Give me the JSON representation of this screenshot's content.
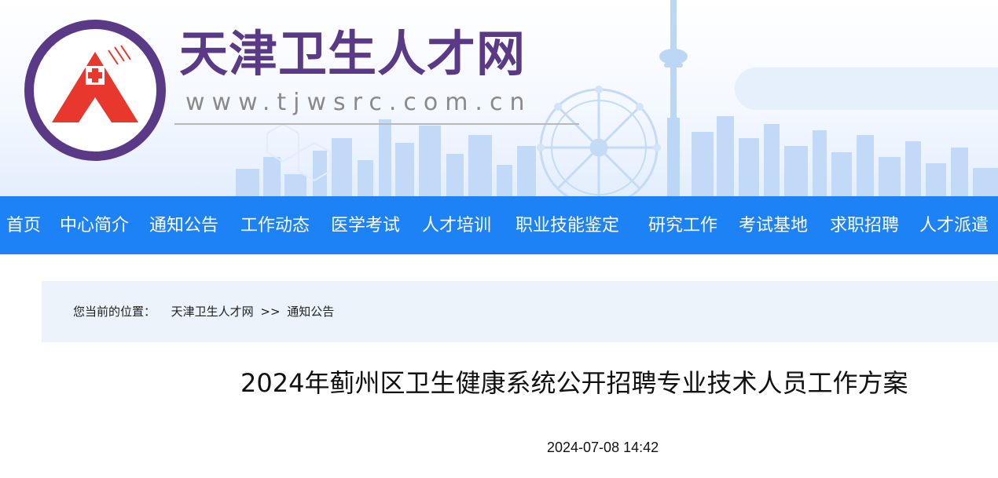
{
  "header": {
    "site_name": "天津卫生人才网",
    "site_url": "www.tjwsrc.com.cn",
    "logo_icon": "red-cross-mountain-logo-icon",
    "colors": {
      "logo_ring": "#5a3a86",
      "logo_red": "#e8372c",
      "skyline": "#b9d4f5"
    }
  },
  "nav": {
    "background": "#1e82f7",
    "items": [
      {
        "label": "首页"
      },
      {
        "label": "中心简介"
      },
      {
        "label": "通知公告"
      },
      {
        "label": "工作动态"
      },
      {
        "label": "医学考试"
      },
      {
        "label": "人才培训"
      },
      {
        "label": "职业技能鉴定"
      },
      {
        "label": "研究工作"
      },
      {
        "label": "考试基地"
      },
      {
        "label": "求职招聘"
      },
      {
        "label": "人才派遣"
      }
    ]
  },
  "breadcrumb": {
    "prefix": "您当前的位置：",
    "items": [
      "天津卫生人才网",
      "通知公告"
    ],
    "separator": ">>"
  },
  "article": {
    "title": "2024年蓟州区卫生健康系统公开招聘专业技术人员工作方案",
    "date": "2024-07-08 14:42"
  }
}
